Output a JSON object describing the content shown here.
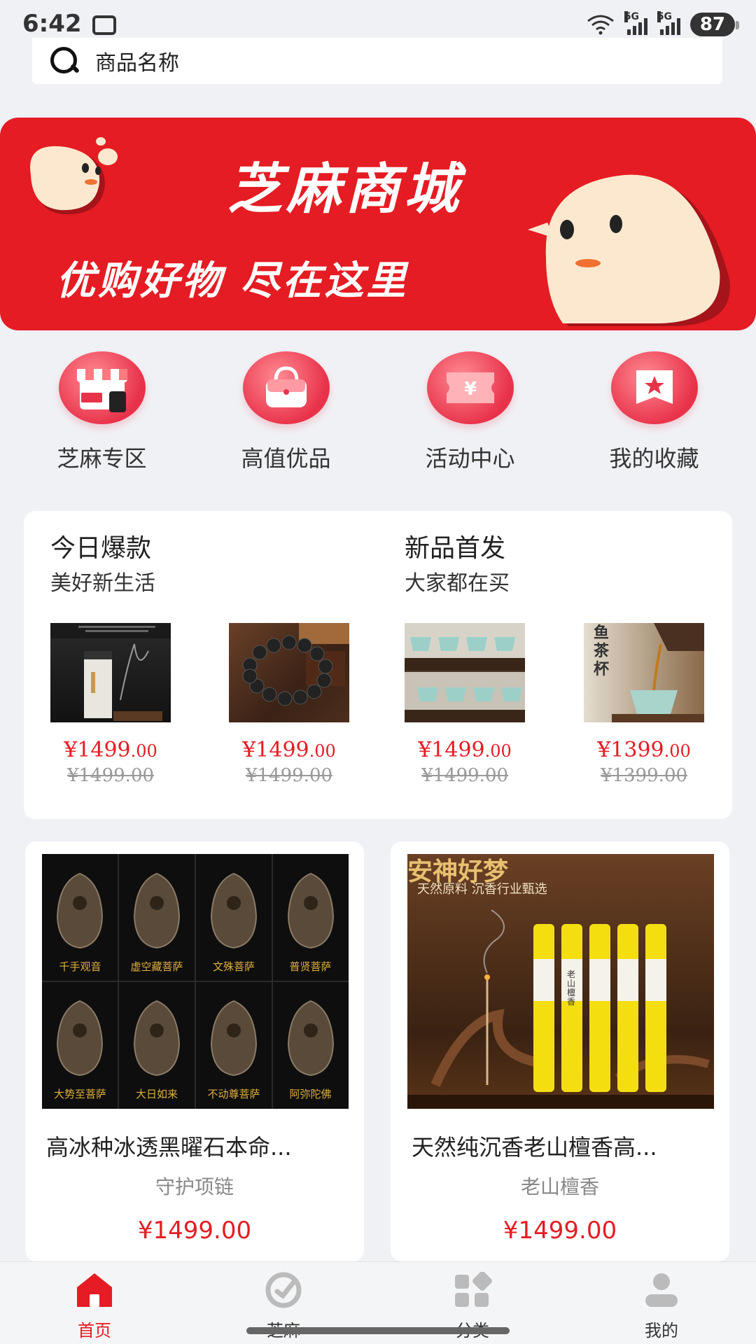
{
  "status_bar": {
    "time": "6:42",
    "network_1": "5G",
    "network_2": "5G",
    "battery": "87"
  },
  "search": {
    "placeholder": "商品名称"
  },
  "banner": {
    "title": "芝麻商城",
    "slogan": "优购好物 尽在这里",
    "accent": "#e51c23"
  },
  "quick_entries": [
    {
      "label": "芝麻专区",
      "icon": "shop-icon"
    },
    {
      "label": "高值优品",
      "icon": "bag-icon"
    },
    {
      "label": "活动中心",
      "icon": "ticket-icon"
    },
    {
      "label": "我的收藏",
      "icon": "star-bookmark-icon"
    }
  ],
  "hot_panel": {
    "left": {
      "title": "今日爆款",
      "subtitle": "美好新生活"
    },
    "right": {
      "title": "新品首发",
      "subtitle": "大家都在买"
    },
    "items": [
      {
        "price_int": "¥1499",
        "price_dec": ".00",
        "old_price": "¥1499.00"
      },
      {
        "price_int": "¥1499",
        "price_dec": ".00",
        "old_price": "¥1499.00"
      },
      {
        "price_int": "¥1499",
        "price_dec": ".00",
        "old_price": "¥1499.00"
      },
      {
        "price_int": "¥1399",
        "price_dec": ".00",
        "old_price": "¥1399.00"
      }
    ],
    "thumb4_text": "鱼茶杯"
  },
  "products": [
    {
      "title": "高冰种冰透黑曜石本命...",
      "subtitle": "守护项链",
      "price": "¥1499.00",
      "image_captions": [
        "千手观音",
        "虚空藏菩萨",
        "文殊菩萨",
        "普贤菩萨",
        "大势至菩萨",
        "大日如来",
        "不动尊菩萨",
        "阿弥陀佛"
      ]
    },
    {
      "title": "天然纯沉香老山檀香高...",
      "subtitle": "老山檀香",
      "price": "¥1499.00",
      "image_title": "安神好梦",
      "image_sub": "天然原料 沉香行业甄选",
      "stick_label": "老山檀香"
    }
  ],
  "tabbar": {
    "items": [
      {
        "label": "首页",
        "icon": "home-icon",
        "active": true
      },
      {
        "label": "芝麻",
        "icon": "sesame-icon",
        "active": false
      },
      {
        "label": "分类",
        "icon": "category-icon",
        "active": false
      },
      {
        "label": "我的",
        "icon": "user-icon",
        "active": false
      }
    ],
    "active_color": "#e51c23"
  }
}
